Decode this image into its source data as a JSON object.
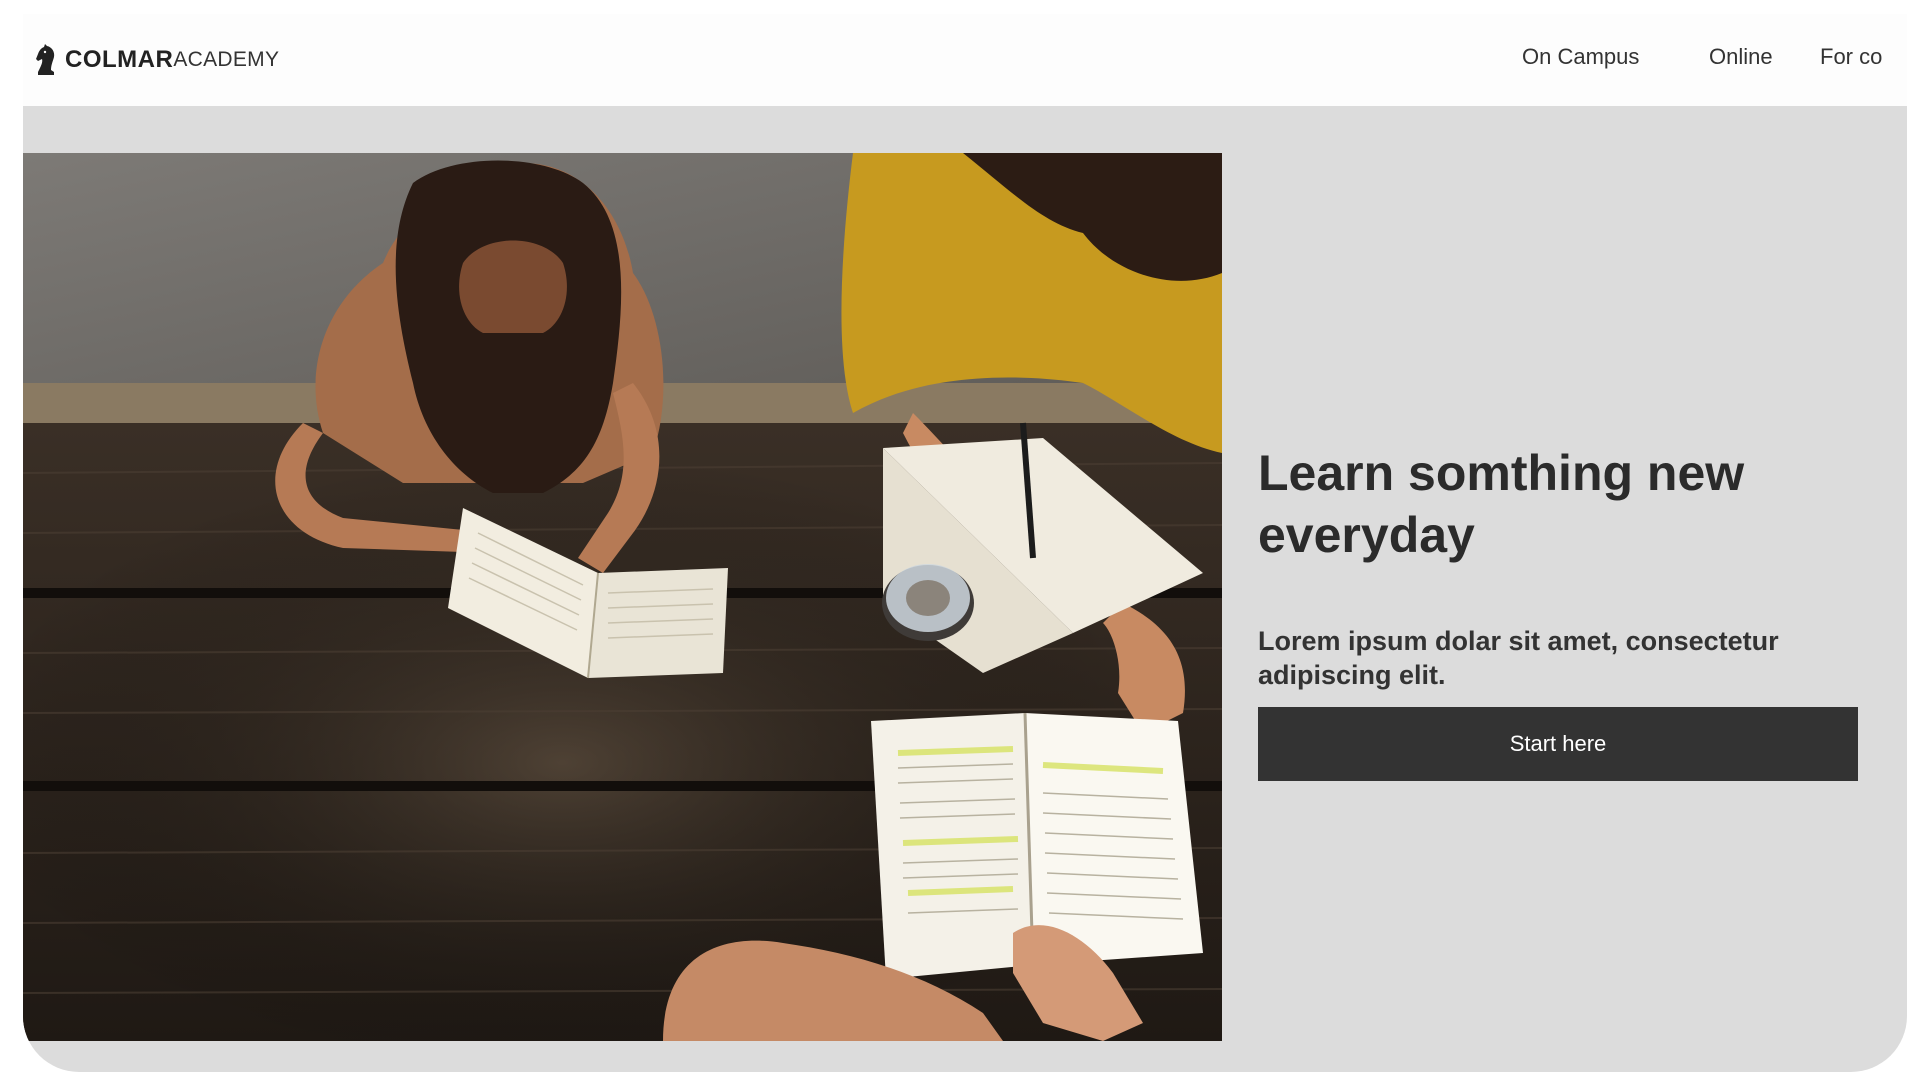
{
  "nav": {
    "logo": {
      "icon": "knight-chess-icon",
      "strong": "COLMAR",
      "light": "ACADEMY"
    },
    "links": [
      {
        "label": "On Campus"
      },
      {
        "label": "Online"
      },
      {
        "label": "For co"
      }
    ]
  },
  "hero": {
    "image_alt": "Students reading books at a wooden table",
    "title": "Learn somthing new everyday",
    "subtitle": "Lorem ipsum dolar sit amet, consectetur adipiscing elit.",
    "cta_label": "Start here"
  },
  "colors": {
    "page_bg": "#ffffff",
    "hero_bg": "#dcdcdc",
    "button_bg": "#333333",
    "button_text": "#ffffff",
    "heading_text": "#2b2b2b"
  }
}
